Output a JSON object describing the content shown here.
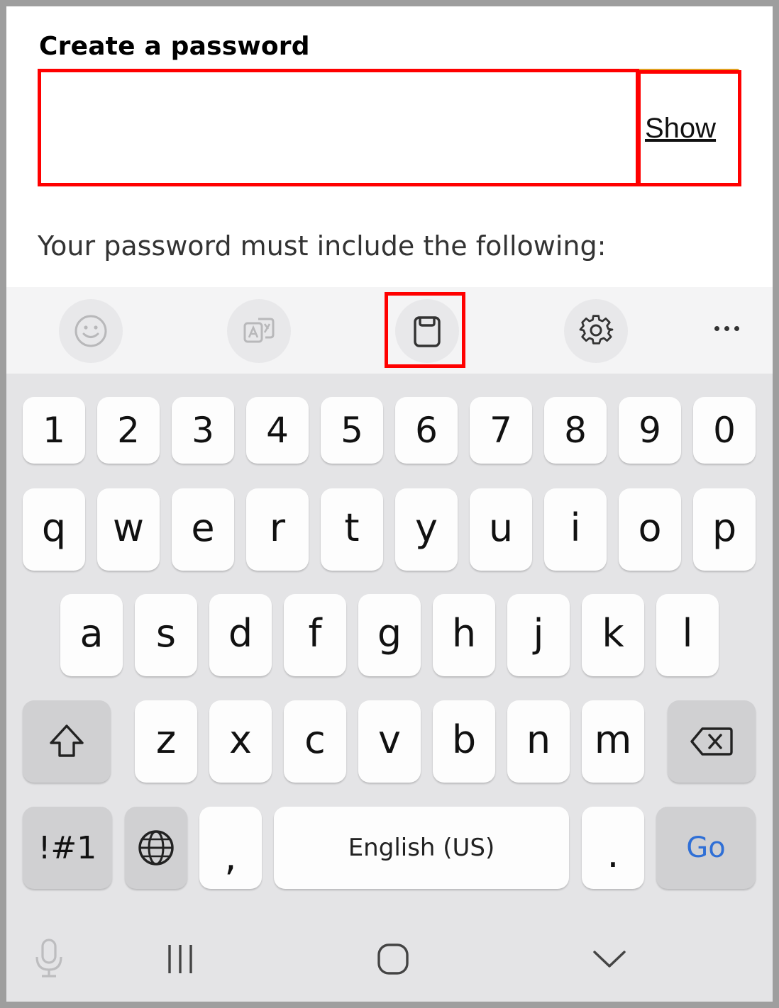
{
  "form": {
    "label": "Create a password",
    "password_value": "",
    "show_label": "Show",
    "hint": "Your password must include the following:"
  },
  "toolbar": {
    "items": [
      {
        "icon": "emoji-icon"
      },
      {
        "icon": "translate-icon"
      },
      {
        "icon": "clipboard-icon"
      },
      {
        "icon": "settings-gear-icon"
      },
      {
        "icon": "more-options-icon"
      }
    ]
  },
  "keyboard": {
    "number_row": [
      "1",
      "2",
      "3",
      "4",
      "5",
      "6",
      "7",
      "8",
      "9",
      "0"
    ],
    "row1": [
      "q",
      "w",
      "e",
      "r",
      "t",
      "y",
      "u",
      "i",
      "o",
      "p"
    ],
    "row2": [
      "a",
      "s",
      "d",
      "f",
      "g",
      "h",
      "j",
      "k",
      "l"
    ],
    "row3": [
      "z",
      "x",
      "c",
      "v",
      "b",
      "n",
      "m"
    ],
    "symbols_label": "!#1",
    "comma_label": ",",
    "space_label": "English (US)",
    "period_label": ".",
    "go_label": "Go",
    "accent_color": "#2f6fd6"
  },
  "navbar": {
    "items": [
      {
        "icon": "microphone-icon"
      },
      {
        "icon": "recent-apps-icon"
      },
      {
        "icon": "home-icon"
      },
      {
        "icon": "hide-keyboard-icon"
      }
    ]
  },
  "highlight_color": "#ff0000"
}
